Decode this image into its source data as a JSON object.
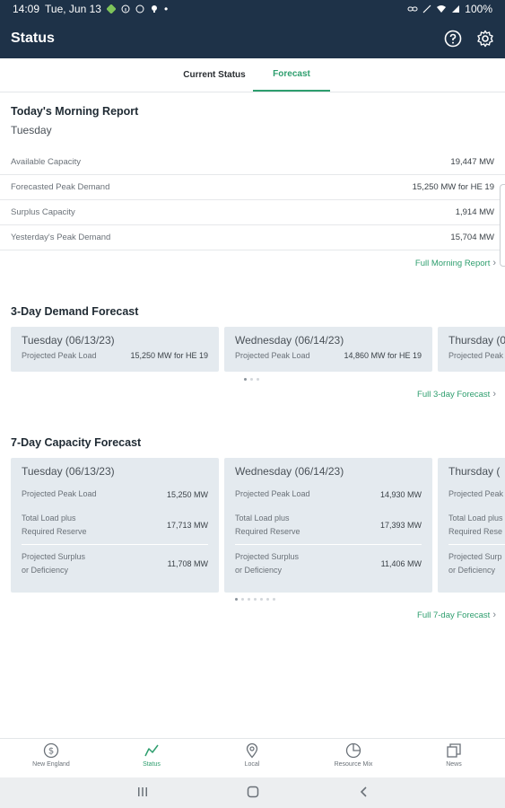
{
  "status_bar": {
    "time": "14:09",
    "date": "Tue, Jun 13",
    "battery": "100%"
  },
  "app_bar": {
    "title": "Status"
  },
  "tabs": {
    "current": "Current Status",
    "forecast": "Forecast"
  },
  "morning_report": {
    "title": "Today's Morning Report",
    "day": "Tuesday",
    "rows": [
      {
        "label": "Available Capacity",
        "value": "19,447 MW"
      },
      {
        "label": "Forecasted Peak Demand",
        "value": "15,250 MW for HE 19"
      },
      {
        "label": "Surplus Capacity",
        "value": "1,914 MW"
      },
      {
        "label": "Yesterday's Peak Demand",
        "value": "15,704 MW"
      }
    ],
    "link": "Full Morning Report"
  },
  "demand_forecast": {
    "title": "3-Day Demand Forecast",
    "cards": [
      {
        "day": "Tuesday (06/13/23)",
        "label": "Projected Peak Load",
        "value": "15,250 MW for HE 19"
      },
      {
        "day": "Wednesday (06/14/23)",
        "label": "Projected Peak Load",
        "value": "14,860 MW for HE 19"
      },
      {
        "day": "Thursday (0",
        "label": "Projected Peak",
        "value": ""
      }
    ],
    "link": "Full 3-day Forecast"
  },
  "capacity_forecast": {
    "title": "7-Day Capacity Forecast",
    "cards": [
      {
        "day": "Tuesday (06/13/23)",
        "peak_label": "Projected Peak Load",
        "peak": "15,250 MW",
        "total_label_1": "Total Load plus",
        "total_label_2": "Required Reserve",
        "total": "17,713 MW",
        "surplus_label_1": "Projected Surplus",
        "surplus_label_2": "or Deficiency",
        "surplus": "11,708 MW"
      },
      {
        "day": "Wednesday (06/14/23)",
        "peak_label": "Projected Peak Load",
        "peak": "14,930 MW",
        "total_label_1": "Total Load plus",
        "total_label_2": "Required Reserve",
        "total": "17,393 MW",
        "surplus_label_1": "Projected Surplus",
        "surplus_label_2": "or Deficiency",
        "surplus": "11,406 MW"
      },
      {
        "day": "Thursday (",
        "peak_label": "Projected Peak",
        "peak": "",
        "total_label_1": "Total Load plus",
        "total_label_2": "Required Rese",
        "total": "",
        "surplus_label_1": "Projected Surp",
        "surplus_label_2": "or Deficiency",
        "surplus": ""
      }
    ],
    "link": "Full 7-day Forecast"
  },
  "bottom_nav": [
    {
      "label": "New England",
      "icon": "dollar-circle-icon"
    },
    {
      "label": "Status",
      "icon": "trend-line-icon"
    },
    {
      "label": "Local",
      "icon": "location-pin-icon"
    },
    {
      "label": "Resource Mix",
      "icon": "pie-chart-icon"
    },
    {
      "label": "News",
      "icon": "news-icon"
    }
  ],
  "colors": {
    "header": "#1e3248",
    "accent": "#2e9e6e",
    "card": "#e4eaef"
  }
}
